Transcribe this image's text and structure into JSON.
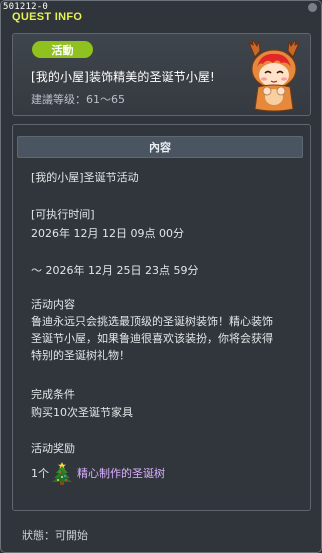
{
  "window": {
    "quest_id": "501212-0",
    "title": "QUEST INFO"
  },
  "header": {
    "category": "活動",
    "quest_title": "[我的小屋]装饰精美的圣诞节小屋!",
    "level_text": "建議等级：61～65"
  },
  "content": {
    "section_title": "內容",
    "lines": [
      "[我的小屋]圣诞节活动",
      "[可执行时间]",
      "2026年 12月 12日 09点 00分",
      "～ 2026年 12月 25日 23点 59分",
      "活动内容",
      "鲁迪永远只会挑选最顶级的圣诞树装饰！精心装饰",
      "圣诞节小屋，如果鲁迪很喜欢该装扮，你将会获得",
      "特别的圣诞树礼物！",
      "完成条件",
      "购买10次圣诞节家具",
      "活动奖励"
    ],
    "reward": {
      "quantity": "1个",
      "icon": "christmas-tree-icon",
      "name": "精心制作的圣诞树"
    }
  },
  "footer": {
    "status": "狀態：可開始"
  },
  "colors": {
    "title_yellow": "#e9f055",
    "category_green": "#8fc21e",
    "reward_purple": "#d9b0ff"
  }
}
